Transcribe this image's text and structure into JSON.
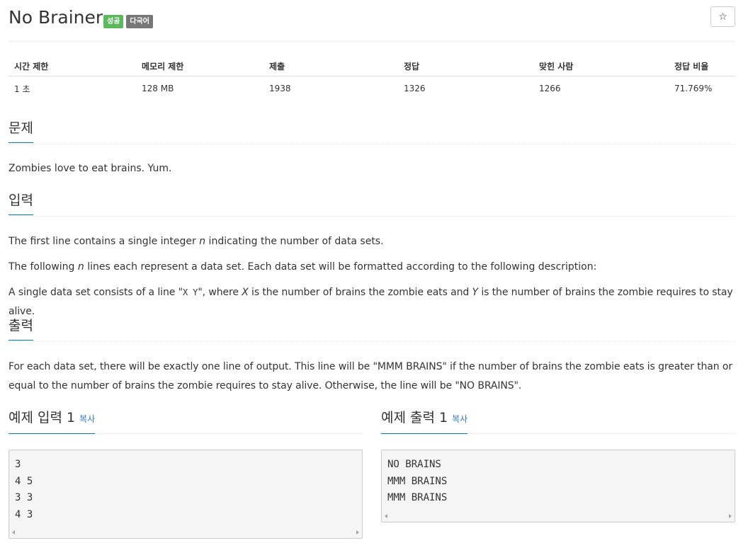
{
  "problem": {
    "title": "No Brainer",
    "badges": {
      "success": "성공",
      "multilang": "다국어"
    },
    "star_icon": "☆"
  },
  "info_table": {
    "headers": [
      "시간 제한",
      "메모리 제한",
      "제출",
      "정답",
      "맞힌 사람",
      "정답 비율"
    ],
    "values": [
      "1 초",
      "128 MB",
      "1938",
      "1326",
      "1266",
      "71.769%"
    ]
  },
  "sections": {
    "problem": {
      "heading": "문제",
      "text": "Zombies love to eat brains. Yum."
    },
    "input": {
      "heading": "입력",
      "line1": {
        "before": "The first line contains a single integer ",
        "var": "n",
        "after": " indicating the number of data sets."
      },
      "line2": {
        "before": "The following ",
        "var": "n",
        "after": " lines each represent a data set. Each data set will be formatted according to the following description:"
      },
      "line3": {
        "before": "A single data set consists of a line \"",
        "code": "X Y",
        "middle": "\", where ",
        "var_x": "X",
        "middle2": " is the number of brains the zombie eats and ",
        "var_y": "Y",
        "after": " is the number of brains the zombie requires to stay alive."
      }
    },
    "output": {
      "heading": "출력",
      "text": "For each data set, there will be exactly one line of output. This line will be \"MMM BRAINS\" if the number of brains the zombie eats is greater than or equal to the number of brains the zombie requires to stay alive. Otherwise, the line will be \"NO BRAINS\"."
    }
  },
  "samples": {
    "input": {
      "label": "예제 입력 1",
      "copy": "복사",
      "content": "3\n4 5\n3 3\n4 3"
    },
    "output": {
      "label": "예제 출력 1",
      "copy": "복사",
      "content": "NO BRAINS\nMMM BRAINS\nMMM BRAINS"
    }
  }
}
